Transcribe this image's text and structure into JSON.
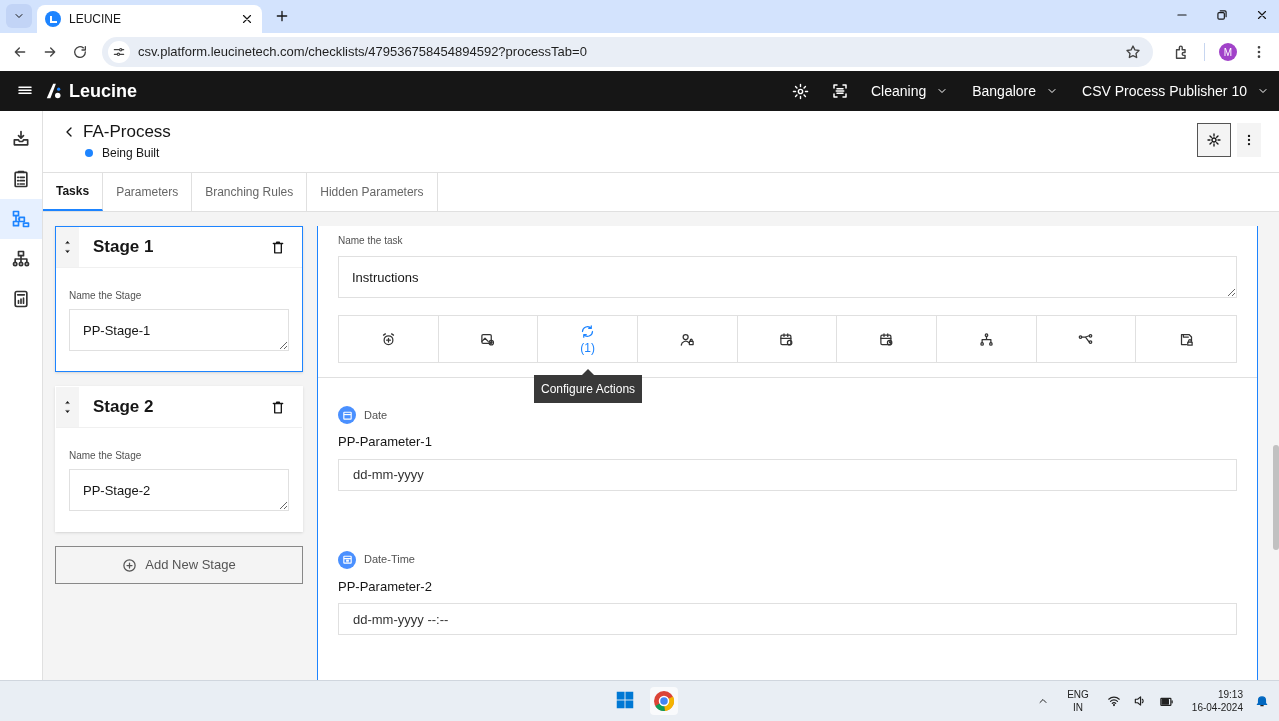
{
  "browser": {
    "tab_title": "LEUCINE",
    "url": "csv.platform.leucinetech.com/checklists/479536758454894592?processTab=0",
    "profile_initial": "M"
  },
  "app_header": {
    "brand": "Leucine",
    "menus": [
      "Cleaning",
      "Bangalore",
      "CSV Process Publisher 10"
    ]
  },
  "nav_rail": [
    {
      "kind": "inbox",
      "selected": false
    },
    {
      "kind": "checklist",
      "selected": false
    },
    {
      "kind": "flow",
      "selected": true
    },
    {
      "kind": "hierarchy",
      "selected": false
    },
    {
      "kind": "report",
      "selected": false
    }
  ],
  "process": {
    "title": "FA-Process",
    "status": "Being Built",
    "color": "#1d84ff"
  },
  "tabs": [
    {
      "label": "Tasks",
      "selected": true
    },
    {
      "label": "Parameters",
      "selected": false
    },
    {
      "label": "Branching Rules",
      "selected": false
    },
    {
      "label": "Hidden Parameters",
      "selected": false
    }
  ],
  "stages": [
    {
      "title": "Stage 1",
      "label": "Name the Stage",
      "value": "PP-Stage-1",
      "selected": true
    },
    {
      "title": "Stage 2",
      "label": "Name the Stage",
      "value": "PP-Stage-2",
      "selected": false
    }
  ],
  "add_stage": "Add New Stage",
  "task": {
    "label": "Name the task",
    "value": "Instructions",
    "toolbar": [
      {
        "kind": "timer",
        "active": false
      },
      {
        "kind": "media",
        "active": false
      },
      {
        "kind": "actions",
        "active": true,
        "count": "(1)"
      },
      {
        "kind": "permissions",
        "active": false
      },
      {
        "kind": "schedule",
        "active": false
      },
      {
        "kind": "due",
        "active": false
      },
      {
        "kind": "hierarchy",
        "active": false
      },
      {
        "kind": "branch",
        "active": false
      },
      {
        "kind": "lock",
        "active": false
      }
    ],
    "tooltip": "Configure Actions"
  },
  "parameters": [
    {
      "kind": "date",
      "type_label": "Date",
      "name": "PP-Parameter-1",
      "placeholder": "dd-mm-yyyy"
    },
    {
      "kind": "datetime",
      "type_label": "Date-Time",
      "name": "PP-Parameter-2",
      "placeholder": "dd-mm-yyyy --:--"
    }
  ],
  "taskbar": {
    "language": "ENG",
    "region": "IN",
    "time": "19:13",
    "date": "16-04-2024"
  }
}
